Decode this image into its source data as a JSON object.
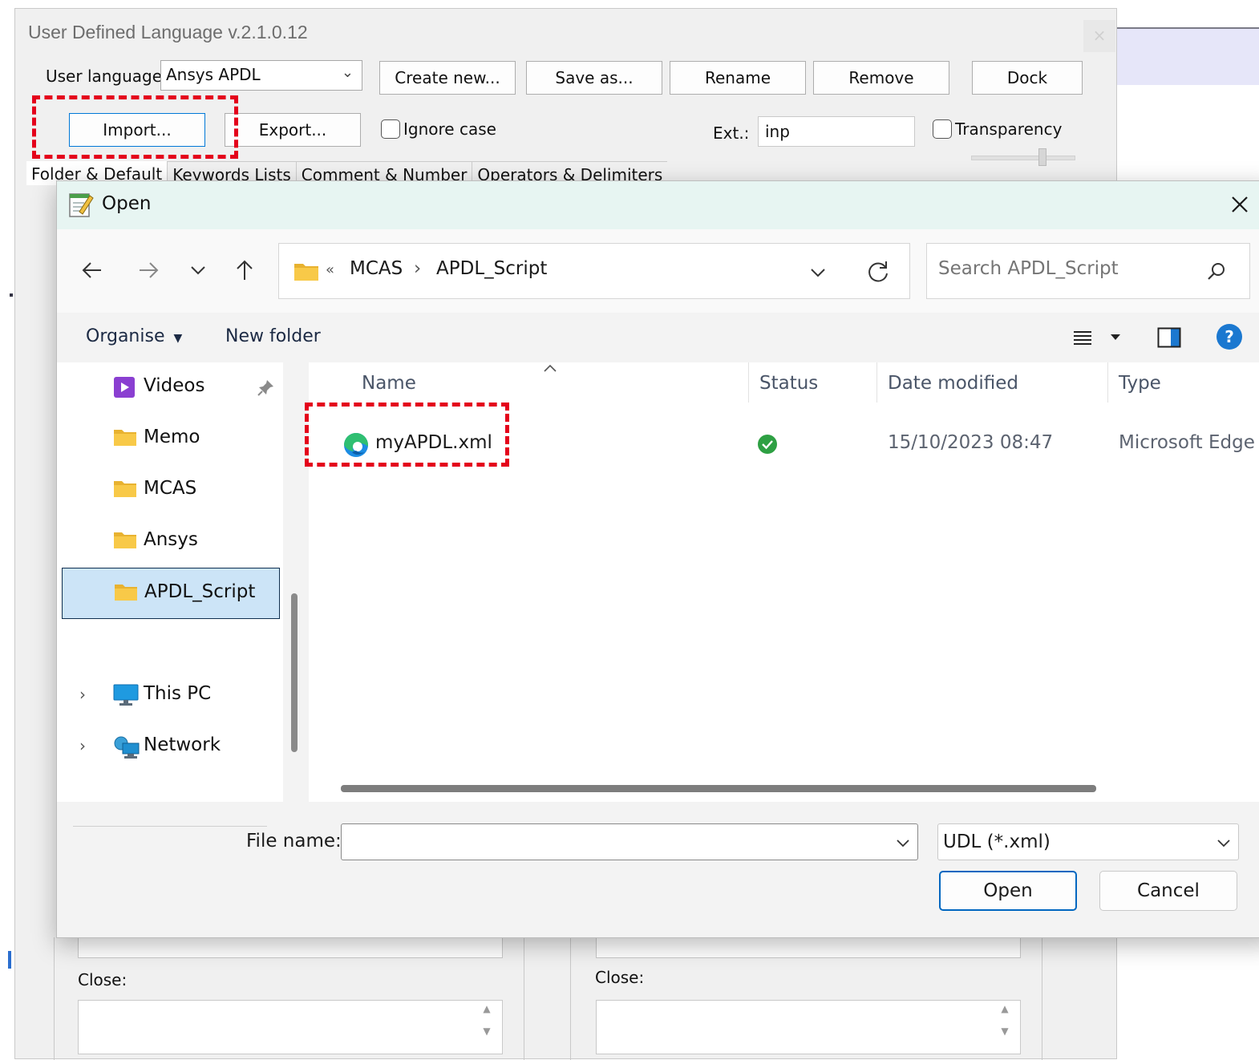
{
  "udl": {
    "title": "User Defined Language v.2.1.0.12",
    "close_glyph": "×",
    "user_language_label": "User language:",
    "user_language_value": "Ansys APDL",
    "buttons": {
      "create_new": "Create new...",
      "save_as": "Save as...",
      "rename": "Rename",
      "remove": "Remove",
      "dock": "Dock",
      "import": "Import...",
      "export": "Export..."
    },
    "ignore_case_label": "Ignore case",
    "ext_label": "Ext.:",
    "ext_value": "inp",
    "transparency_label": "Transparency",
    "tabs": [
      "Folder & Default",
      "Keywords Lists",
      "Comment & Number",
      "Operators & Delimiters"
    ],
    "close_label_left": "Close:",
    "close_label_right": "Close:"
  },
  "dialog": {
    "title": "Open",
    "breadcrumb": {
      "overflow": "«",
      "items": [
        "MCAS",
        "APDL_Script"
      ],
      "separator": "›"
    },
    "search_placeholder": "Search APDL_Script",
    "toolbar": {
      "organise": "Organise",
      "new_folder": "New folder"
    },
    "nav": [
      {
        "label": "Videos",
        "icon": "videos-icon",
        "pinned": true
      },
      {
        "label": "Memo",
        "icon": "folder-icon"
      },
      {
        "label": "MCAS",
        "icon": "folder-icon"
      },
      {
        "label": "Ansys",
        "icon": "folder-icon"
      },
      {
        "label": "APDL_Script",
        "icon": "folder-icon",
        "selected": true
      },
      {
        "label": "This PC",
        "icon": "this-pc-icon",
        "expandable": true
      },
      {
        "label": "Network",
        "icon": "network-icon",
        "expandable": true
      }
    ],
    "columns": {
      "name": "Name",
      "status": "Status",
      "date_modified": "Date modified",
      "type": "Type"
    },
    "files": [
      {
        "name": "myAPDL.xml",
        "icon": "edge-icon",
        "status": "synced",
        "date_modified": "15/10/2023 08:47",
        "type": "Microsoft Edge H"
      }
    ],
    "file_name_label": "File name:",
    "file_name_value": "",
    "file_type": "UDL (*.xml)",
    "open_button": "Open",
    "cancel_button": "Cancel"
  },
  "colors": {
    "highlight_red": "#e4001b",
    "accent_blue": "#0067c0",
    "selection": "#cce4f7",
    "status_green": "#2ea043",
    "folder_yellow": "#f8c948"
  }
}
